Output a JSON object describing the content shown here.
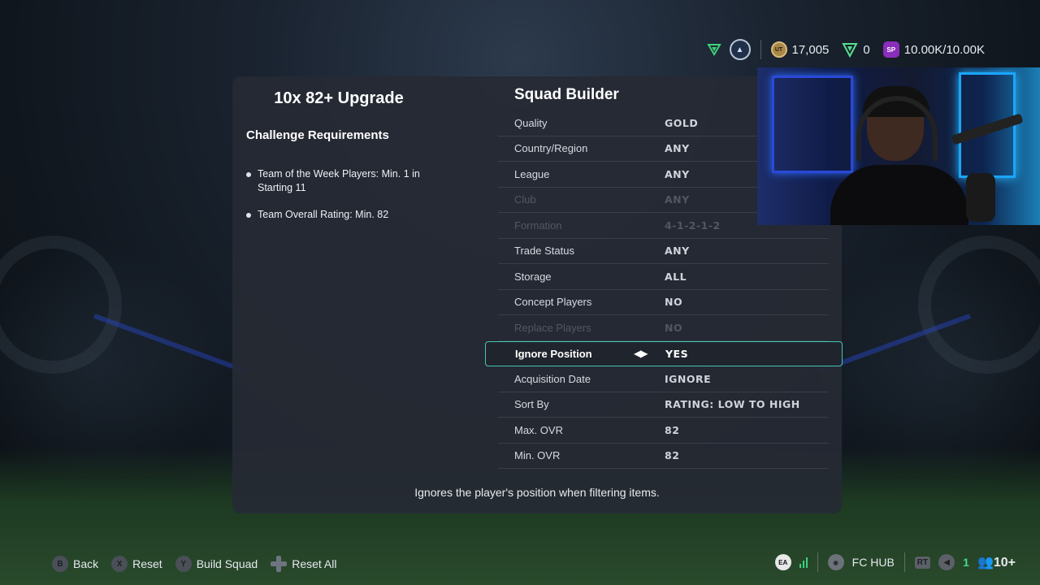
{
  "topbar": {
    "coins": "17,005",
    "points": "0",
    "sp": "10.00K/10.00K",
    "coin_icon_text": "UT",
    "sp_icon_text": "SP"
  },
  "challenge": {
    "title": "10x 82+ Upgrade",
    "requirements_heading": "Challenge Requirements",
    "requirements": [
      "Team of the Week Players: Min. 1 in Starting 11",
      "Team Overall Rating: Min. 82"
    ]
  },
  "squad_builder": {
    "title": "Squad Builder",
    "rows": [
      {
        "label": "Quality",
        "value": "GOLD"
      },
      {
        "label": "Country/Region",
        "value": "ANY"
      },
      {
        "label": "League",
        "value": "ANY"
      },
      {
        "label": "Club",
        "value": "ANY"
      },
      {
        "label": "Formation",
        "value": "4-1-2-1-2"
      },
      {
        "label": "Trade Status",
        "value": "ANY"
      },
      {
        "label": "Storage",
        "value": "ALL"
      },
      {
        "label": "Concept Players",
        "value": "NO"
      },
      {
        "label": "Replace Players",
        "value": "NO"
      },
      {
        "label": "Ignore Position",
        "value": "YES"
      },
      {
        "label": "Acquisition Date",
        "value": "IGNORE"
      },
      {
        "label": "Sort By",
        "value": "RATING: LOW TO HIGH"
      },
      {
        "label": "Max. OVR",
        "value": "82"
      },
      {
        "label": "Min. OVR",
        "value": "82"
      }
    ],
    "hint": "Ignores the player's position when filtering items."
  },
  "bottom_controls": {
    "back": {
      "key": "B",
      "label": "Back"
    },
    "reset": {
      "key": "X",
      "label": "Reset"
    },
    "build": {
      "key": "Y",
      "label": "Build Squad"
    },
    "reset_all": {
      "label": "Reset All"
    }
  },
  "bottom_right": {
    "ea_icon_text": "EA",
    "fc_hub": "FC HUB",
    "rt": "RT",
    "notif_count": "1",
    "friends": "10+"
  },
  "colors": {
    "accent": "#46c6b7",
    "panel": "#262a34",
    "sp_purple": "#8a2dbb",
    "online_green": "#49d88a"
  }
}
